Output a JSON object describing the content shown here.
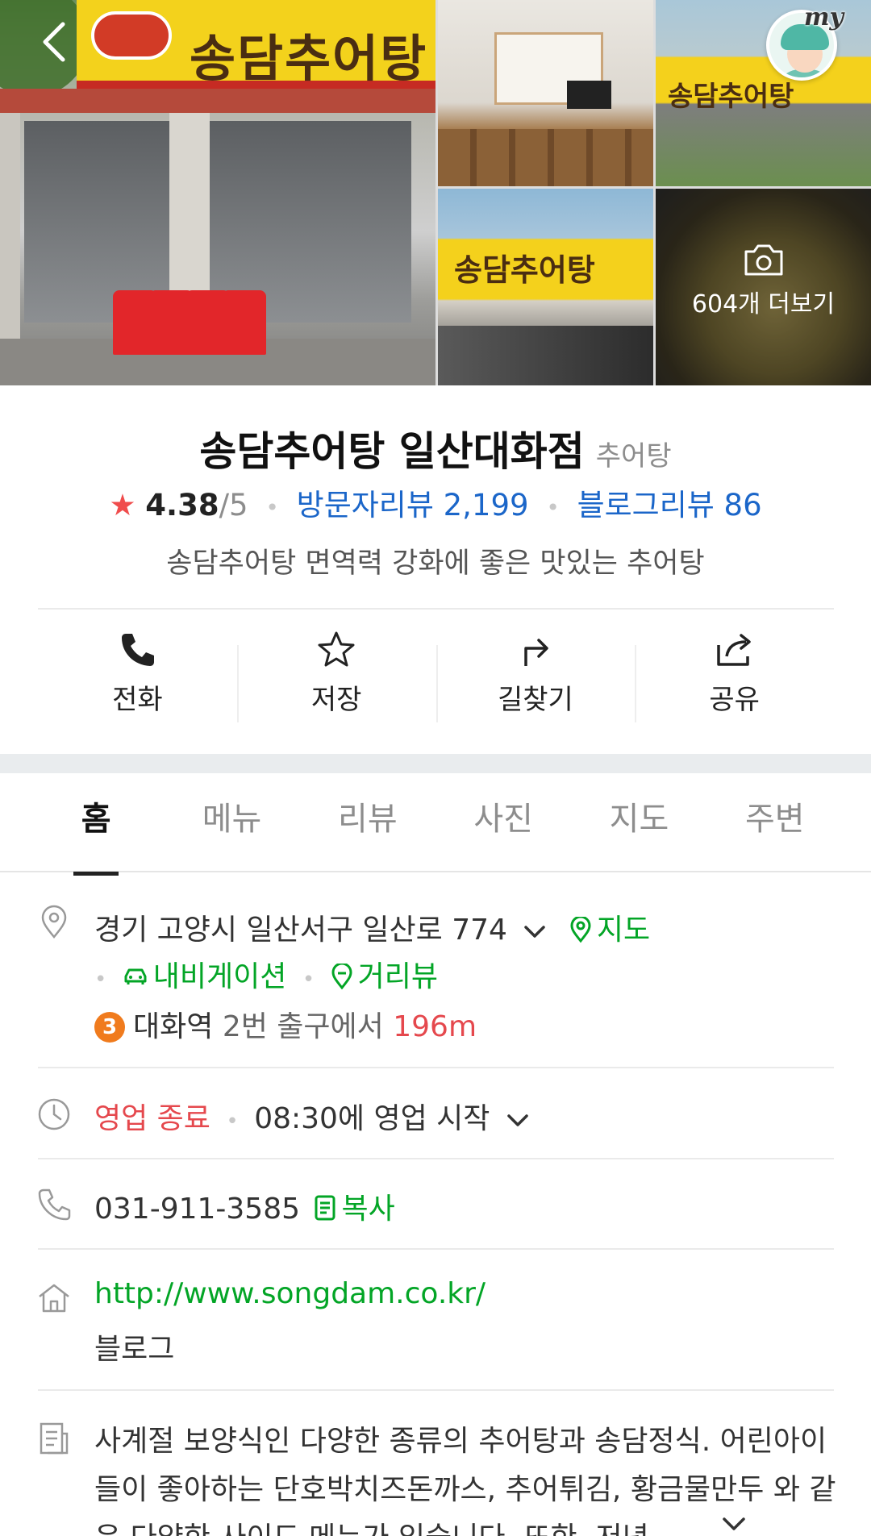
{
  "gallery": {
    "more_label": "604개 더보기",
    "sign_text": "송담추어탕",
    "my_label": "my"
  },
  "place": {
    "name": "송담추어탕 일산대화점",
    "category": "추어탕",
    "rating": "4.38",
    "rating_max": "/5",
    "visitor_reviews": "방문자리뷰 2,199",
    "blog_reviews": "블로그리뷰 86",
    "tagline": "송담추어탕 면역력 강화에 좋은 맛있는 추어탕"
  },
  "actions": [
    {
      "label": "전화",
      "icon": "phone-icon"
    },
    {
      "label": "저장",
      "icon": "star-icon"
    },
    {
      "label": "길찾기",
      "icon": "directions-icon"
    },
    {
      "label": "공유",
      "icon": "share-icon"
    }
  ],
  "tabs": [
    "홈",
    "메뉴",
    "리뷰",
    "사진",
    "지도",
    "주변"
  ],
  "info": {
    "address": "경기 고양시 일산서구 일산로 774",
    "map_link": "지도",
    "navigation_link": "내비게이션",
    "street_view_link": "거리뷰",
    "subway_line": "3",
    "station": "대화역",
    "exit_text": "2번 출구에서",
    "distance": "196m",
    "status": "영업 종료",
    "hours": "08:30에 영업 시작",
    "phone": "031-911-3585",
    "copy_label": "복사",
    "website": "http://www.songdam.co.kr/",
    "blog_link": "블로그",
    "description": "사계절 보양식인 다양한 종류의 추어탕과 송담정식. 어린아이들이 좋아하는 단호박치즈돈까스, 추어튀김, 황금물만두 와 같은 다양한 사이드 메뉴가 있습니다. 또한, 저녁"
  },
  "colors": {
    "accent_green": "#03a526",
    "link_blue": "#1b66c9",
    "closed_red": "#e5484d",
    "star_red": "#f04c4c",
    "line3_orange": "#f07b1d"
  }
}
